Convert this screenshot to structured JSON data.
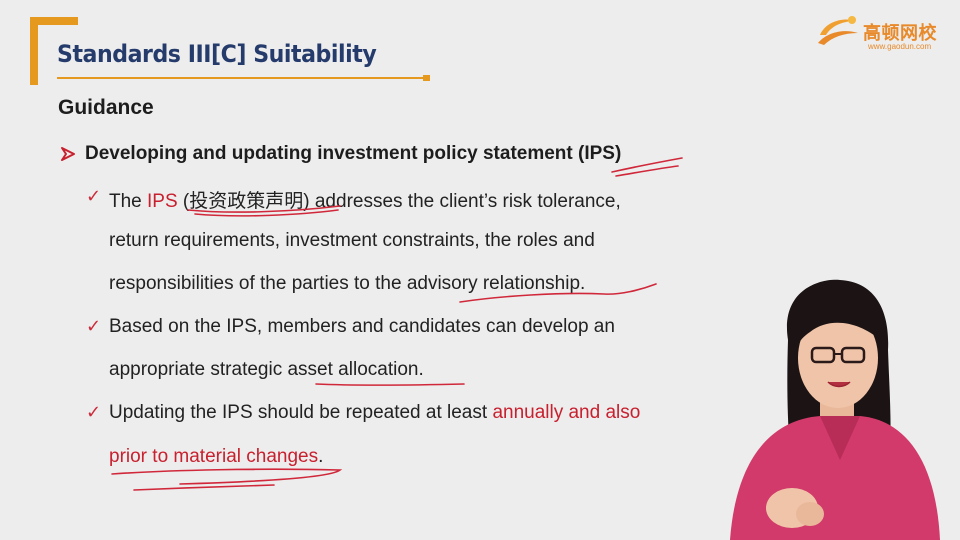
{
  "slide": {
    "title": "Standards III[C] Suitability",
    "section_heading": "Guidance",
    "main_bullet": "Developing and updating investment policy statement (IPS)"
  },
  "logo": {
    "name": "高顿网校",
    "url": "www.gaodun.com"
  },
  "points": [
    {
      "lines": [
        {
          "pre": "The ",
          "red": "IPS",
          "mid": " (投资政策声明) addresses the client’s risk tolerance,"
        },
        {
          "text": "return requirements, investment constraints, the roles and"
        },
        {
          "text": "responsibilities of the parties to the advisory relationship."
        }
      ]
    },
    {
      "lines": [
        {
          "text": "Based on the IPS, members and candidates can develop an"
        },
        {
          "text": "appropriate strategic asset allocation."
        }
      ]
    },
    {
      "lines": [
        {
          "pre": "Updating the IPS should be repeated at least ",
          "red": "annually and also"
        },
        {
          "red": "prior to material changes",
          "post": "."
        }
      ]
    }
  ],
  "colors": {
    "accent_orange": "#e59a1f",
    "title_navy": "#243b6b",
    "highlight_red": "#c8202e",
    "presenter_shirt": "#d13a6a"
  }
}
